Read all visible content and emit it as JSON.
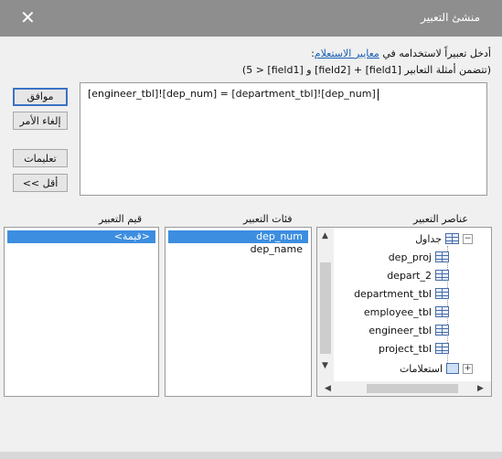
{
  "window": {
    "title": "منشئ التعبير"
  },
  "instructions": {
    "line1_prefix": "أدخل تعبيراً لاستخدامه في ",
    "line1_link": "معايير الاستعلام",
    "line1_suffix": ":",
    "line2": "(تتضمن أمثلة التعابير [field1] + [field2] و [field1] < 5)"
  },
  "buttons": {
    "ok": "موافق",
    "cancel": "إلغاء الأمر",
    "help": "تعليمات",
    "less": "<< أقل"
  },
  "expression": {
    "text": "[engineer_tbl]![dep_num] = [department_tbl]![dep_num]"
  },
  "labels": {
    "elements": "عناصر التعبير",
    "categories": "فئات التعبير",
    "values": "قيم التعبير"
  },
  "values_list": [
    "<قيمة>"
  ],
  "categories_list": [
    "dep_num",
    "dep_name"
  ],
  "tree": {
    "tables_label": "جداول",
    "tables": [
      "dep_proj",
      "depart_2",
      "department_tbl",
      "employee_tbl",
      "engineer_tbl",
      "project_tbl"
    ],
    "queries_label": "استعلامات"
  }
}
